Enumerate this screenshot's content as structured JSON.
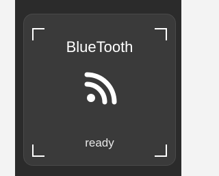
{
  "device": {
    "title": "BlueTooth",
    "status": "ready",
    "icon": "rss-feed-icon"
  },
  "colors": {
    "page_background": "#f3f3f3",
    "panel_background": "#2b2b2b",
    "card_background": "#3a3a3a",
    "text": "#ffffff"
  }
}
